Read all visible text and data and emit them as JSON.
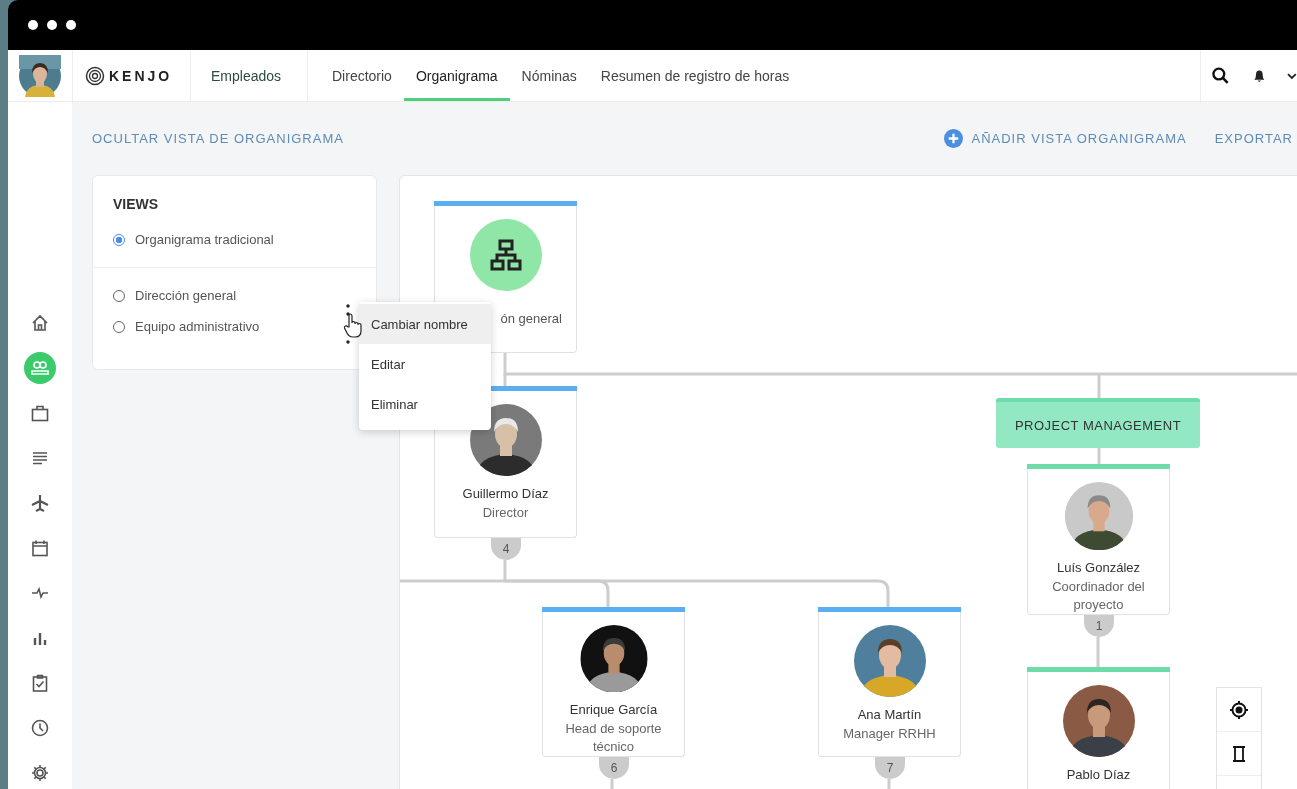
{
  "header": {
    "logo": "KENJO",
    "section": "Empleados",
    "tabs": [
      {
        "label": "Directorio",
        "selected": false
      },
      {
        "label": "Organigrama",
        "selected": true
      },
      {
        "label": "Nóminas",
        "selected": false
      },
      {
        "label": "Resumen de registro de horas",
        "selected": false
      }
    ]
  },
  "sidebar": {
    "items": [
      {
        "kind": "home",
        "selected": false
      },
      {
        "kind": "people",
        "selected": true
      },
      {
        "kind": "briefcase",
        "selected": false
      },
      {
        "kind": "list",
        "selected": false
      },
      {
        "kind": "plane",
        "selected": false
      },
      {
        "kind": "calendar",
        "selected": false
      },
      {
        "kind": "pulse",
        "selected": false
      },
      {
        "kind": "chart",
        "selected": false
      },
      {
        "kind": "clipboard",
        "selected": false
      },
      {
        "kind": "clock",
        "selected": false
      },
      {
        "kind": "gear",
        "selected": false
      }
    ]
  },
  "toolbar": {
    "hide_link": "OCULTAR VISTA DE ORGANIGRAMA",
    "add_link": "AÑADIR VISTA ORGANIGRAMA",
    "export_link": "EXPORTAR"
  },
  "views": {
    "title": "VIEWS",
    "groups": [
      [
        {
          "label": "Organigrama tradicional",
          "selected": true
        }
      ],
      [
        {
          "label": "Dirección general",
          "selected": false
        },
        {
          "label": "Equipo administrativo",
          "selected": false
        }
      ]
    ]
  },
  "context_menu": {
    "items": [
      {
        "label": "Cambiar nombre",
        "highlighted": true
      },
      {
        "label": "Editar",
        "highlighted": false
      },
      {
        "label": "Eliminar",
        "highlighted": false
      }
    ]
  },
  "org_chart": {
    "department": {
      "label": "PROJECT MANAGEMENT"
    },
    "nodes": [
      {
        "kind": "unit",
        "title": "ón general",
        "color": "#5aaef2"
      },
      {
        "kind": "person",
        "name": "Guillermo Díaz",
        "role": "Director",
        "count": "4",
        "color": "#5aaef2"
      },
      {
        "kind": "person",
        "name": "Enrique García",
        "role": "Head de soporte técnico",
        "count": "6",
        "color": "#5aaef2"
      },
      {
        "kind": "person",
        "name": "Ana Martín",
        "role": "Manager RRHH",
        "count": "7",
        "color": "#5aaef2"
      },
      {
        "kind": "person",
        "name": "Luís González",
        "role": "Coordinador del proyecto",
        "count": "1",
        "color": "#6ddcaa"
      },
      {
        "kind": "person",
        "name": "Pablo Díaz",
        "color": "#6ddcaa"
      }
    ]
  }
}
